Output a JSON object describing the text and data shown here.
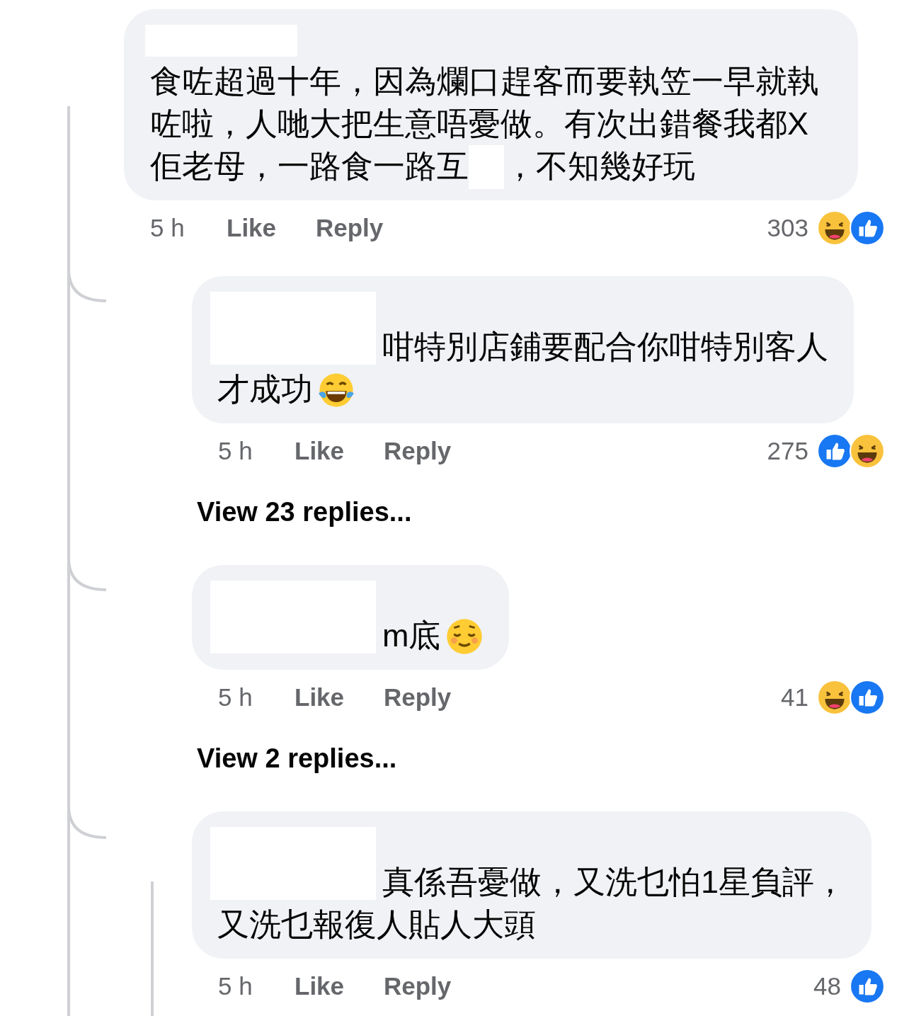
{
  "comment": {
    "lines": [
      [
        {
          "kind": "name_hidden"
        }
      ],
      [
        {
          "kind": "text",
          "text": "食咗超過十年，因為爛口趕客而要執笠一早就執"
        }
      ],
      [
        {
          "kind": "text",
          "text": "咗啦，人哋大把生意唔憂做。有次出錯餐我都X"
        }
      ],
      [
        {
          "kind": "text",
          "text": "佢老母，一路食一路互"
        },
        {
          "kind": "hidden"
        },
        {
          "kind": "text",
          "text": "，不知幾好玩"
        }
      ]
    ],
    "time": "5 h",
    "like": "Like",
    "reply": "Reply",
    "count": "303",
    "reactions": [
      {
        "kind": "haha"
      },
      {
        "kind": "like"
      }
    ]
  },
  "replies": [
    {
      "lines": [
        [
          {
            "kind": "name_hidden"
          },
          {
            "kind": "text",
            "text": "咁特別店鋪要配合你咁特別客人"
          }
        ],
        [
          {
            "kind": "text",
            "text": "才成功"
          },
          {
            "kind": "laughcry"
          }
        ]
      ],
      "time": "5 h",
      "like": "Like",
      "reply": "Reply",
      "count": "275",
      "reactions": [
        {
          "kind": "like"
        },
        {
          "kind": "haha"
        }
      ],
      "more": "View 23 replies..."
    },
    {
      "lines": [
        [
          {
            "kind": "name_hidden"
          },
          {
            "kind": "text",
            "text": "m底"
          },
          {
            "kind": "relieved"
          }
        ]
      ],
      "time": "5 h",
      "like": "Like",
      "reply": "Reply",
      "count": "41",
      "reactions": [
        {
          "kind": "haha"
        },
        {
          "kind": "like"
        }
      ],
      "more": "View 2 replies..."
    },
    {
      "lines": [
        [
          {
            "kind": "name_hidden"
          },
          {
            "kind": "text",
            "text": "真係吾憂做，又洗乜怕1星負評，"
          }
        ],
        [
          {
            "kind": "text",
            "text": "又洗乜報復人貼人大頭"
          }
        ]
      ],
      "time": "5 h",
      "like": "Like",
      "reply": "Reply",
      "count": "48",
      "reactions": [
        {
          "kind": "like"
        }
      ]
    }
  ]
}
